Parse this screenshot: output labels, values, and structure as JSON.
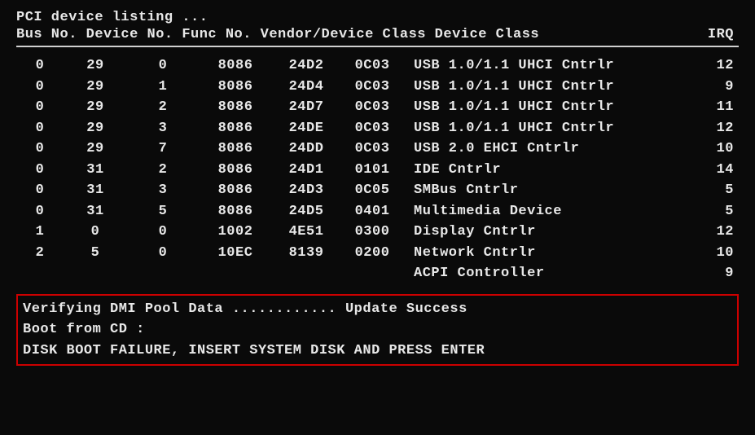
{
  "header": {
    "title": "PCI device listing ...",
    "cols_left": "Bus No. Device No. Func No. Vendor/Device Class Device Class",
    "irq": "IRQ"
  },
  "rows": [
    {
      "bus": "0",
      "dev": "29",
      "func": "0",
      "vendor": "8086",
      "cls": "24D2",
      "code": "0C03",
      "desc": "USB 1.0/1.1 UHCI Cntrlr",
      "irq": "12"
    },
    {
      "bus": "0",
      "dev": "29",
      "func": "1",
      "vendor": "8086",
      "cls": "24D4",
      "code": "0C03",
      "desc": "USB 1.0/1.1 UHCI Cntrlr",
      "irq": "9"
    },
    {
      "bus": "0",
      "dev": "29",
      "func": "2",
      "vendor": "8086",
      "cls": "24D7",
      "code": "0C03",
      "desc": "USB 1.0/1.1 UHCI Cntrlr",
      "irq": "11"
    },
    {
      "bus": "0",
      "dev": "29",
      "func": "3",
      "vendor": "8086",
      "cls": "24DE",
      "code": "0C03",
      "desc": "USB 1.0/1.1 UHCI Cntrlr",
      "irq": "12"
    },
    {
      "bus": "0",
      "dev": "29",
      "func": "7",
      "vendor": "8086",
      "cls": "24DD",
      "code": "0C03",
      "desc": "USB 2.0 EHCI Cntrlr",
      "irq": "10"
    },
    {
      "bus": "0",
      "dev": "31",
      "func": "2",
      "vendor": "8086",
      "cls": "24D1",
      "code": "0101",
      "desc": "IDE Cntrlr",
      "irq": "14"
    },
    {
      "bus": "0",
      "dev": "31",
      "func": "3",
      "vendor": "8086",
      "cls": "24D3",
      "code": "0C05",
      "desc": "SMBus Cntrlr",
      "irq": "5"
    },
    {
      "bus": "0",
      "dev": "31",
      "func": "5",
      "vendor": "8086",
      "cls": "24D5",
      "code": "0401",
      "desc": "Multimedia Device",
      "irq": "5"
    },
    {
      "bus": "1",
      "dev": "0",
      "func": "0",
      "vendor": "1002",
      "cls": "4E51",
      "code": "0300",
      "desc": "Display Cntrlr",
      "irq": "12"
    },
    {
      "bus": "2",
      "dev": "5",
      "func": "0",
      "vendor": "10EC",
      "cls": "8139",
      "code": "0200",
      "desc": "Network Cntrlr",
      "irq": "10"
    }
  ],
  "acpi": {
    "desc": "ACPI Controller",
    "irq": "9"
  },
  "footer": {
    "line1": "Verifying DMI Pool Data ............ Update Success",
    "line2": "Boot from CD :",
    "line3": "DISK BOOT FAILURE, INSERT SYSTEM DISK AND PRESS ENTER"
  }
}
